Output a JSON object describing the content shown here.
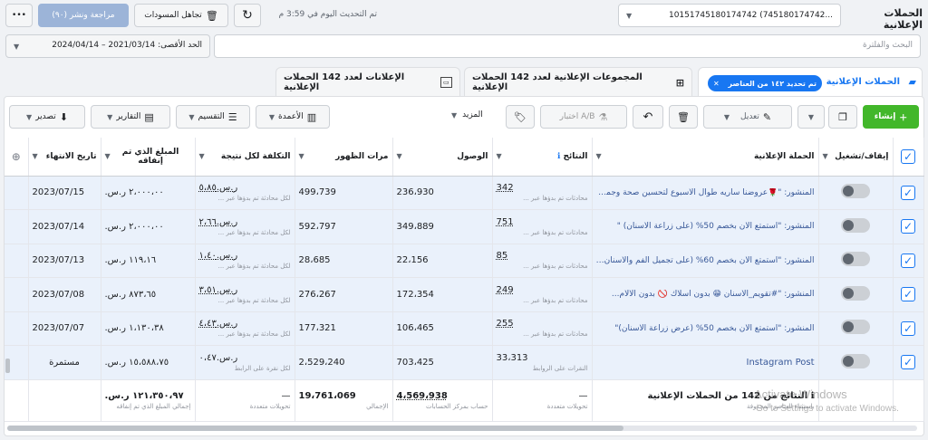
{
  "topbar": {
    "more_label": "•••",
    "review_publish_label": "مراجعة ونشر (٩٠)",
    "discard_drafts_label": "تجاهل المسودات",
    "updated_label": "تم التحديث اليوم في 3:59 م",
    "account_value": "10151745180174742 (745180174742...",
    "page_title": "الحملات الإعلانية"
  },
  "search": {
    "placeholder": "البحث والفلترة"
  },
  "daterange": {
    "label": "الحد الأقصى: 2021/03/14 – 2024/04/14"
  },
  "tabs": {
    "campaigns": "الحملات الإعلانية",
    "campaigns_chip": "تم تحديد ١٤٢ من العناصر",
    "adsets": "المجموعات الإعلانية لعدد 142 الحملات الإعلانية",
    "ads": "الإعلانات لعدد 142 الحملات الإعلانية"
  },
  "toolbar": {
    "create": "إنشاء",
    "edit": "تعديل",
    "ab_test": "اختبار A/B",
    "more": "المزيد",
    "columns": "الأعمدة",
    "breakdown": "التقسيم",
    "reports": "التقارير",
    "export": "تصدير"
  },
  "columns": {
    "toggle": "إيقاف/تشغيل",
    "campaign": "الحملة الإعلانية",
    "results": "النتائج",
    "reach": "الوصول",
    "impressions": "مرات الظهور",
    "cost_per_result": "التكلفة لكل نتيجة",
    "amount_spent": "المبلغ الذي تم إنفاقه",
    "end_date": "تاريخ الانتهاء"
  },
  "rows": [
    {
      "campaign": "المنشور: \"🌹عروضنا ساريه طوال الأسبوع لتحسين صحة وجمال...",
      "results": "342",
      "results_sub": "محادثات تم بدؤها عبر ...",
      "reach": "236،930",
      "impressions": "499،739",
      "cpr": "ر.س.٥،٨٥",
      "cpr_sub": "لكل محادثة تم بدؤها عبر ...",
      "spent": "٢،٠٠٠،٠٠ ر.س.",
      "end": "2023/07/15"
    },
    {
      "campaign": "المنشور: \"استمتع الآن بخصم 50% (على زراعة الأسنان) \"",
      "results": "751",
      "results_sub": "محادثات تم بدؤها عبر ...",
      "reach": "349،889",
      "impressions": "592،797",
      "cpr": "ر.س.٢،٦٦",
      "cpr_sub": "لكل محادثة تم بدؤها عبر ...",
      "spent": "٢،٠٠٠،٠٠ ر.س.",
      "end": "2023/07/14"
    },
    {
      "campaign": "المنشور: \"استمتع الآن بخصم 60% (على تجميل الفم والأسنان)...\"",
      "results": "85",
      "results_sub": "محادثات تم بدؤها عبر ...",
      "reach": "22،156",
      "impressions": "28،685",
      "cpr": "ر.س.١،٤٠",
      "cpr_sub": "لكل محادثة تم بدؤها عبر ...",
      "spent": "١١٩،١٦ ر.س.",
      "end": "2023/07/13"
    },
    {
      "campaign": "المنشور: \"#تقويم_الأسنان 😁 بدون أسلاك 🚫 بدون الألام...",
      "results": "249",
      "results_sub": "محادثات تم بدؤها عبر ...",
      "reach": "172،354",
      "impressions": "276،267",
      "cpr": "ر.س.٣،٥١",
      "cpr_sub": "لكل محادثة تم بدؤها عبر ...",
      "spent": "٨٧٣،٦٥ ر.س.",
      "end": "2023/07/08"
    },
    {
      "campaign": "المنشور: \"استمتع الآن بخصم 50% (عرض زراعة الأسنان)\"",
      "results": "255",
      "results_sub": "محادثات تم بدؤها عبر ...",
      "reach": "106،465",
      "impressions": "177،321",
      "cpr": "ر.س.٤،٤٣",
      "cpr_sub": "لكل محادثة تم بدؤها عبر ...",
      "spent": "١،١٣٠،٣٨ ر.س.",
      "end": "2023/07/07"
    },
    {
      "campaign": "Instagram Post",
      "results": "33،313",
      "results_sub": "النقرات على الروابط",
      "reach": "703،425",
      "impressions": "2،529،240",
      "cpr": "ر.س.٠،٤٧",
      "cpr_sub": "لكل نقرة على الرابط",
      "spent": "١٥،٥٨٨،٧٥ ر.س.",
      "end": "مستمرة"
    }
  ],
  "total": {
    "label": "النتائج من 142 من الحملات الإعلانية",
    "label_sub": "باستثناء العناصر المحذوفة",
    "results": "—",
    "results_sub": "تحويلات متعددة",
    "reach": "4،569،938",
    "reach_sub": "حساب بمركز الحسابات",
    "impressions": "19،761،069",
    "impressions_sub": "الإجمالي",
    "cpr": "—",
    "cpr_sub": "تحويلات متعددة",
    "spent": "١٢١،٣٥٠،٩٧ ر.س.",
    "spent_sub": "إجمالي المبلغ الذي تم إنفاقه"
  },
  "watermark": {
    "title": "Activate Windows",
    "subtitle": "Go to Settings to activate Windows."
  }
}
